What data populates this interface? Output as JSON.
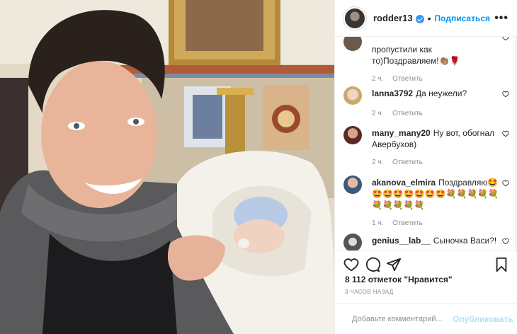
{
  "header": {
    "username": "rodder13",
    "dot": "•",
    "follow_label": "Подписаться",
    "more_label": "•••"
  },
  "comments": [
    {
      "username": "",
      "text": "пропустили как то)Поздравляем!👏🏽🌹",
      "text_line1": "пропустили как",
      "text_line2": "то)Поздравляем!👏🏽🌹",
      "time": "2 ч.",
      "reply": "Ответить"
    },
    {
      "username": "lanna3792",
      "text": "Да неужели?",
      "time": "2 ч.",
      "reply": "Ответить"
    },
    {
      "username": "many_many20",
      "text": "Ну вот, обогнал Авербухов)",
      "text_line2": "Авербухов)",
      "time": "2 ч.",
      "reply": "Ответить"
    },
    {
      "username": "akanova_elmira",
      "text": "Поздравляю🤩",
      "emoji_line1": "🤩🤩🤩🤩🤩🤩🤩💐💐💐💐💐",
      "emoji_line2": "💐💐💐💐💐",
      "time": "1 ч.",
      "reply": "Ответить"
    },
    {
      "username": "genius__lab__",
      "text": "Сыночка Васи?!"
    }
  ],
  "stats": {
    "likes": "8 112 отметок \"Нравится\"",
    "ago": "3 ЧАСОВ НАЗАД"
  },
  "add_comment": {
    "placeholder": "Добавьте комментарий...",
    "publish": "Опубликовать"
  },
  "colors": {
    "accent": "#0095f6",
    "publish_disabled": "#b2dffc",
    "meta_gray": "#8e8e8e"
  },
  "icons": {
    "like": "heart-icon",
    "comment": "comment-icon",
    "share": "share-icon",
    "save": "bookmark-icon",
    "emoji": "smiley-icon",
    "verified": "verified-badge-icon"
  }
}
